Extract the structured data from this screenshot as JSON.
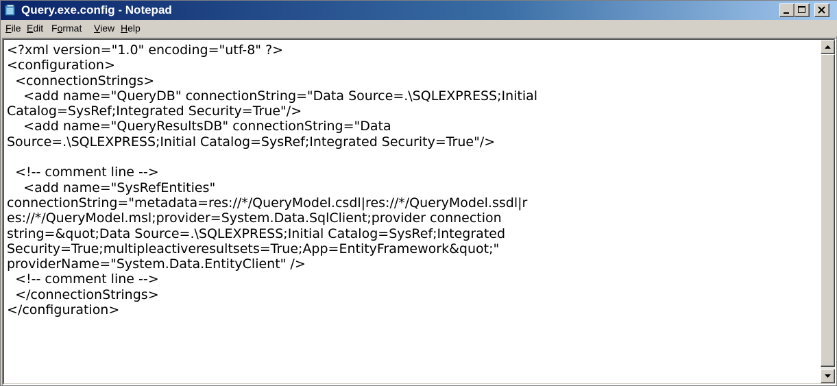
{
  "window": {
    "title": "Query.exe.config - Notepad",
    "titlebar_color": "#0a246a"
  },
  "menu": {
    "items": [
      {
        "accel": "F",
        "rest": "ile"
      },
      {
        "accel": "E",
        "rest": "dit"
      },
      {
        "pre": "F",
        "accel": "o",
        "rest": "rmat"
      },
      {
        "accel": "V",
        "rest": "iew"
      },
      {
        "accel": "H",
        "rest": "elp"
      }
    ]
  },
  "editor": {
    "lines": [
      "<?xml version=\"1.0\" encoding=\"utf-8\" ?>",
      "<configuration>",
      "  <connectionStrings>",
      "    <add name=\"QueryDB\" connectionString=\"Data Source=.\\SQLEXPRESS;Initial",
      "Catalog=SysRef;Integrated Security=True\"/>",
      "    <add name=\"QueryResultsDB\" connectionString=\"Data",
      "Source=.\\SQLEXPRESS;Initial Catalog=SysRef;Integrated Security=True\"/>",
      "",
      "  <!-- comment line -->",
      "    <add name=\"SysRefEntities\"",
      "connectionString=\"metadata=res://*/QueryModel.csdl|res://*/QueryModel.ssdl|r",
      "es://*/QueryModel.msl;provider=System.Data.SqlClient;provider connection",
      "string=&quot;Data Source=.\\SQLEXPRESS;Initial Catalog=SysRef;Integrated",
      "Security=True;multipleactiveresultsets=True;App=EntityFramework&quot;\"",
      "providerName=\"System.Data.EntityClient\" />",
      "  <!-- comment line -->",
      "  </connectionStrings>",
      "</configuration>"
    ]
  }
}
